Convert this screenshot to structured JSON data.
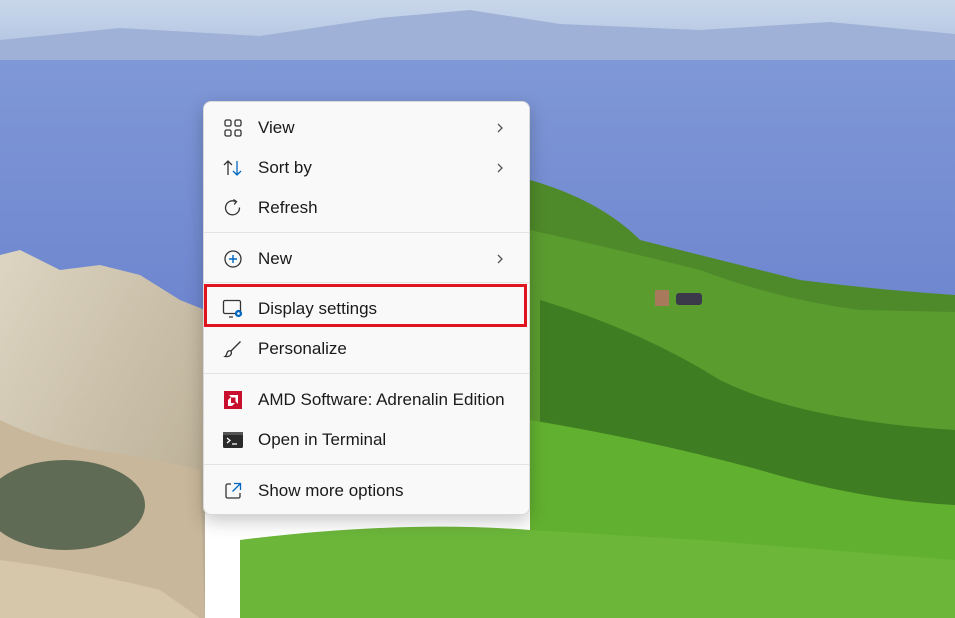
{
  "context_menu": {
    "items": [
      {
        "label": "View",
        "icon": "grid-icon",
        "submenu": true
      },
      {
        "label": "Sort by",
        "icon": "sort-arrows-icon",
        "submenu": true
      },
      {
        "label": "Refresh",
        "icon": "refresh-icon",
        "submenu": false
      },
      {
        "label": "New",
        "icon": "plus-circle-icon",
        "submenu": true
      },
      {
        "label": "Display settings",
        "icon": "display-settings-icon",
        "submenu": false,
        "highlighted": true
      },
      {
        "label": "Personalize",
        "icon": "brush-icon",
        "submenu": false
      },
      {
        "label": "AMD Software: Adrenalin Edition",
        "icon": "amd-logo-icon",
        "submenu": false
      },
      {
        "label": "Open in Terminal",
        "icon": "terminal-icon",
        "submenu": false
      },
      {
        "label": "Show more options",
        "icon": "share-icon",
        "submenu": false
      }
    ],
    "highlight_color": "#e0141e",
    "accent_color": "#0067c0"
  }
}
